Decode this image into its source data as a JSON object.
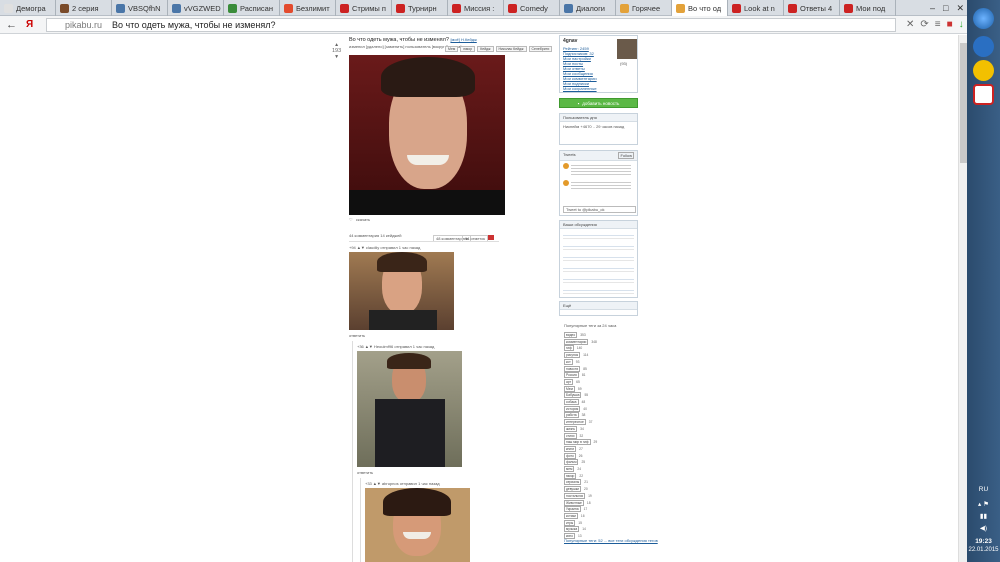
{
  "browser": {
    "tabs": [
      {
        "label": "Демогра",
        "color": "#e0e0e0"
      },
      {
        "label": "2 серия",
        "color": "#7a4b2a"
      },
      {
        "label": "VBSQfhN",
        "color": "#4a76a8"
      },
      {
        "label": "vVGZWED",
        "color": "#4a76a8"
      },
      {
        "label": "Расписан",
        "color": "#3a8c3a"
      },
      {
        "label": "Безлимит",
        "color": "#e34b2e"
      },
      {
        "label": "Стримы п",
        "color": "#cc2222"
      },
      {
        "label": "Турнирн",
        "color": "#cc2222"
      },
      {
        "label": "Миссия :",
        "color": "#cc2222"
      },
      {
        "label": "Comedy",
        "color": "#cc2222"
      },
      {
        "label": "Диалоги",
        "color": "#4a76a8"
      },
      {
        "label": "Горячее",
        "color": "#e3a23a"
      },
      {
        "label": "Во что од",
        "color": "#e3a23a",
        "active": true
      },
      {
        "label": "Look at n",
        "color": "#cc2222"
      },
      {
        "label": "Ответы 4",
        "color": "#cc2222"
      },
      {
        "label": "Мои под",
        "color": "#cc2222"
      }
    ],
    "address": {
      "domain": "pikabu.ru",
      "title": "Во что одеть мужа, чтобы не изменял?"
    }
  },
  "post": {
    "title": "Во что одеть мужа, чтобы не изменял?",
    "title_suffix": "[моё] Н.Кейдж",
    "rating": "193",
    "author_line": "изменил [удалено] [заменить] пользователь [вокруг бархата]",
    "tags": [
      "Мем",
      "юмор",
      "Кейдж",
      "Николас Кейдж",
      "Селебрити"
    ],
    "footer": "44 комментария 14 кейджей",
    "comments_label": "48 комментариев",
    "views_label": "14 отметок"
  },
  "comments": [
    {
      "head": "+94 ▲▼ claudiiy отправил 1 час назад"
    },
    {
      "head": "+36 ▲▼ Heoulmf96 отправил 1 час назад"
    },
    {
      "head": "+33 ▲▼ abrupnos отправил 1 час назад"
    }
  ],
  "sidebar": {
    "user": {
      "name": "4gnav",
      "stats": [
        "Рейтинг: 2459",
        "Подписчиков: 32",
        "Мои настройки",
        "Мои посты",
        "Мои ответы",
        "Мои сообщения",
        "Мои комментарии",
        "Мои подписки",
        "Мои сохраненные"
      ]
    },
    "add_button": "добавить новость",
    "news_block": {
      "title": "Пользователь дня",
      "body": "Никнейм +4670 .. 29 часов назад"
    },
    "tweets_title": "Tweets",
    "follow_label": "Follow",
    "tweet_input": "Tweet to @pikabu_ok",
    "discussions_title": "Ваши обсуждения",
    "more_label": "Ещё",
    "popular_title": "Популярные теги за 24 часа",
    "tags": [
      {
        "name": "видео",
        "count": "353"
      },
      {
        "name": "комментарии",
        "count": "348"
      },
      {
        "name": "гиф",
        "count": "140"
      },
      {
        "name": "рисунок",
        "count": "114"
      },
      {
        "name": "кот",
        "count": "93"
      },
      {
        "name": "новости",
        "count": "85"
      },
      {
        "name": "Россия",
        "count": "81"
      },
      {
        "name": "арт",
        "count": "65"
      },
      {
        "name": "Мем",
        "count": "59"
      },
      {
        "name": "Бабушка",
        "count": "55"
      },
      {
        "name": "собака",
        "count": "48"
      },
      {
        "name": "история",
        "count": "40"
      },
      {
        "name": "работа",
        "count": "38"
      },
      {
        "name": "интересное",
        "count": "37"
      },
      {
        "name": "жизнь",
        "count": "34"
      },
      {
        "name": "стихи",
        "count": "32"
      },
      {
        "name": "наш мир в гиф",
        "count": "29"
      },
      {
        "name": "книги",
        "count": "27"
      },
      {
        "name": "фото",
        "count": "26"
      },
      {
        "name": "фильм",
        "count": "25"
      },
      {
        "name": "мем",
        "count": "24"
      },
      {
        "name": "юмор",
        "count": "22"
      },
      {
        "name": "сериалы",
        "count": "21"
      },
      {
        "name": "девушки",
        "count": "20"
      },
      {
        "name": "ностальгия",
        "count": "19"
      },
      {
        "name": "Животные",
        "count": "18"
      },
      {
        "name": "Украина",
        "count": "17"
      },
      {
        "name": "котики",
        "count": "16"
      },
      {
        "name": "игры",
        "count": "15"
      },
      {
        "name": "музыка",
        "count": "14"
      },
      {
        "name": "кино",
        "count": "13"
      }
    ],
    "popular_footer": "Популярные теги: 52 ... все теги обсуждения тегов"
  },
  "taskbar": {
    "lang": "RU",
    "time": "19:23",
    "date": "22.01.2015"
  }
}
